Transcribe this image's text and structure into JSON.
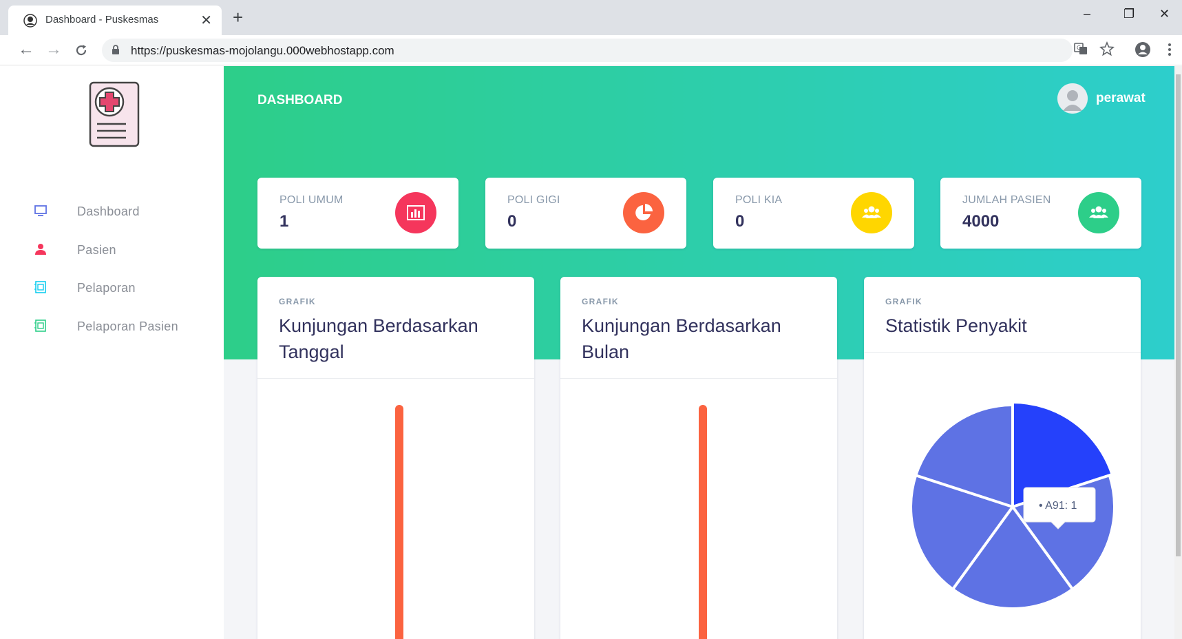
{
  "browser": {
    "tab_title": "Dashboard - Puskesmas",
    "tab_close": "✕",
    "new_tab": "+",
    "url": "https://puskesmas-mojolangu.000webhostapp.com",
    "minimize": "–",
    "restore": "❐",
    "close": "✕"
  },
  "sidebar": {
    "items": [
      {
        "label": "Dashboard",
        "icon": "monitor-icon",
        "color": "#5e72e4"
      },
      {
        "label": "Pasien",
        "icon": "user-icon",
        "color": "#f5365c"
      },
      {
        "label": "Pelaporan",
        "icon": "report-icon",
        "color": "#11cdef"
      },
      {
        "label": "Pelaporan Pasien",
        "icon": "report-icon",
        "color": "#2dce89"
      }
    ]
  },
  "header": {
    "title": "DASHBOARD",
    "user": "perawat"
  },
  "stats": [
    {
      "label": "POLI UMUM",
      "value": "1",
      "icon": "bar-chart-icon",
      "color": "#f5365c"
    },
    {
      "label": "POLI GIGI",
      "value": "0",
      "icon": "pie-chart-icon",
      "color": "#fb6340"
    },
    {
      "label": "POLI KIA",
      "value": "0",
      "icon": "users-icon",
      "color": "#ffd600"
    },
    {
      "label": "JUMLAH PASIEN",
      "value": "4000",
      "icon": "users-icon",
      "color": "#2dce89"
    }
  ],
  "charts": [
    {
      "subtitle": "GRAFIK",
      "title": "Kunjungan Berdasarkan Tanggal"
    },
    {
      "subtitle": "GRAFIK",
      "title": "Kunjungan Berdasarkan Bulan"
    },
    {
      "subtitle": "GRAFIK",
      "title": "Statistik Penyakit"
    }
  ],
  "chart_data": [
    {
      "type": "bar",
      "title": "Kunjungan Berdasarkan Tanggal",
      "series": [
        {
          "values": [
            1
          ]
        }
      ],
      "bar_color": "#fb6340"
    },
    {
      "type": "bar",
      "title": "Kunjungan Berdasarkan Bulan",
      "series": [
        {
          "values": [
            1
          ]
        }
      ],
      "bar_color": "#fb6340"
    },
    {
      "type": "pie",
      "title": "Statistik Penyakit",
      "slices": [
        {
          "label": "A91",
          "value": 1,
          "color": "#2541fb"
        },
        {
          "label": "",
          "value": 1,
          "color": "#5e72e4"
        },
        {
          "label": "",
          "value": 1,
          "color": "#5e72e4"
        },
        {
          "label": "",
          "value": 1,
          "color": "#5e72e4"
        },
        {
          "label": "",
          "value": 1,
          "color": "#5e72e4"
        }
      ],
      "tooltip": "A91: 1"
    }
  ]
}
